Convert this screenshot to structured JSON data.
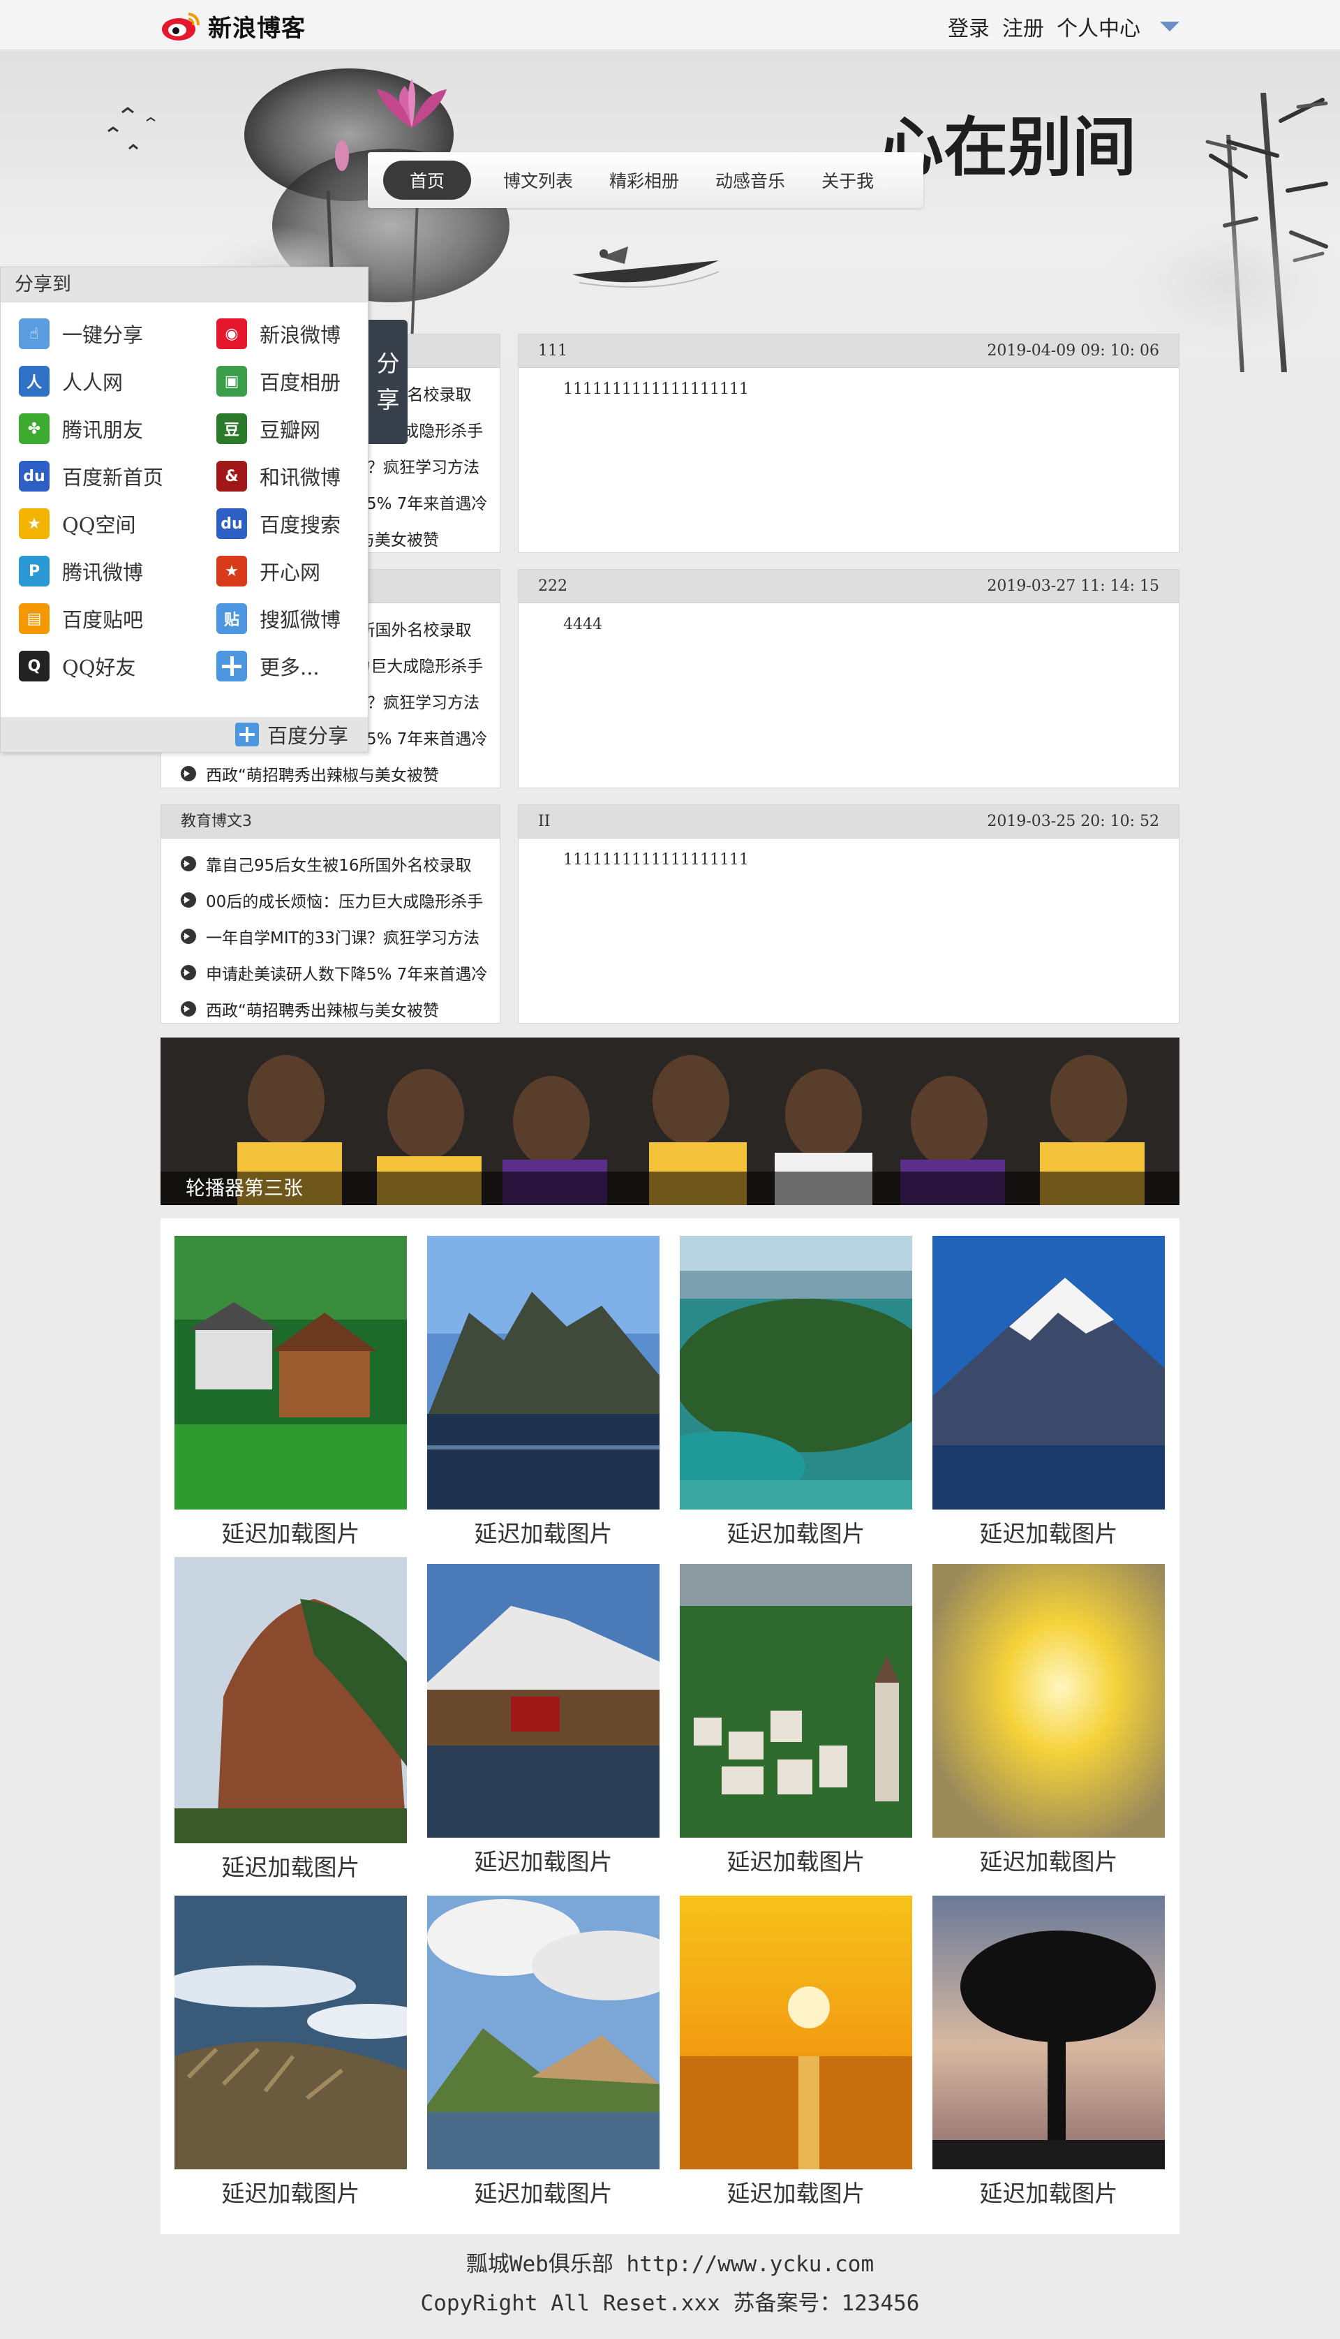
{
  "header": {
    "logo_text": "新浪博客",
    "links": [
      "登录",
      "注册",
      "个人中心"
    ]
  },
  "banner": {
    "calligraphy": "心在别间"
  },
  "nav": {
    "items": [
      "首页",
      "博文列表",
      "精彩相册",
      "动感音乐",
      "关于我"
    ]
  },
  "sections": [
    {
      "category": "",
      "articles": [
        "靠自己95后女生被16所国外名校录取",
        "00后的成长烦恼：压力巨大成隐形杀手",
        "一年自学MIT的33门课？疯狂学习方法",
        "申请赴美读研人数下降5% 7年来首遇冷",
        "西政“萌招聘秀出辣椒与美女被赞"
      ],
      "post_title": "111",
      "post_date": "2019-04-09 09: 10: 06",
      "post_body": "1111111111111111111"
    },
    {
      "category": "",
      "articles": [
        "靠自己95后女生被16所国外名校录取",
        "00后的成长烦恼：压力巨大成隐形杀手",
        "一年自学MIT的33门课？疯狂学习方法",
        "申请赴美读研人数下降5% 7年来首遇冷",
        "西政“萌招聘秀出辣椒与美女被赞"
      ],
      "post_title": "222",
      "post_date": "2019-03-27 11: 14: 15",
      "post_body": "4444"
    },
    {
      "category": "教育博文3",
      "articles": [
        "靠自己95后女生被16所国外名校录取",
        "00后的成长烦恼：压力巨大成隐形杀手",
        "一年自学MIT的33门课？疯狂学习方法",
        "申请赴美读研人数下降5% 7年来首遇冷",
        "西政“萌招聘秀出辣椒与美女被赞"
      ],
      "post_title": "II",
      "post_date": "2019-03-25 20: 10: 52",
      "post_body": "1111111111111111111"
    }
  ],
  "carousel": {
    "caption": "轮播器第三张"
  },
  "gallery": {
    "caption": "延迟加载图片",
    "photos": [
      "house-forest",
      "karst-lake",
      "island-lake",
      "snow-mountain",
      "red-cliff",
      "snow-mountain-pavilion",
      "village-church",
      "golden-sky",
      "snowy-river",
      "green-hills-lake",
      "sunset-sea",
      "lone-tree"
    ]
  },
  "footer": {
    "line1": "瓢城Web俱乐部 http://www.ycku.com",
    "line2": "CopyRight All Reset.xxx 苏备案号：123456"
  },
  "share": {
    "title": "分享到",
    "tab": [
      "分",
      "享"
    ],
    "items": [
      {
        "label": "一键分享",
        "icon": "one-click-share-icon",
        "color": "#5b9be0"
      },
      {
        "label": "新浪微博",
        "icon": "sina-weibo-icon",
        "color": "#e6162d"
      },
      {
        "label": "人人网",
        "icon": "renren-icon",
        "color": "#2f71c4"
      },
      {
        "label": "百度相册",
        "icon": "baidu-album-icon",
        "color": "#3a9e4a"
      },
      {
        "label": "腾讯朋友",
        "icon": "tencent-friends-icon",
        "color": "#3dab2f"
      },
      {
        "label": "豆瓣网",
        "icon": "douban-icon",
        "color": "#2b7a2b"
      },
      {
        "label": "百度新首页",
        "icon": "baidu-home-icon",
        "color": "#2e5fc4"
      },
      {
        "label": "和讯微博",
        "icon": "hexun-weibo-icon",
        "color": "#a01818"
      },
      {
        "label": "QQ空间",
        "icon": "qzone-icon",
        "color": "#f2b400"
      },
      {
        "label": "百度搜索",
        "icon": "baidu-search-icon",
        "color": "#2e5fc4"
      },
      {
        "label": "腾讯微博",
        "icon": "tencent-weibo-icon",
        "color": "#2a98d4"
      },
      {
        "label": "开心网",
        "icon": "kaixin-icon",
        "color": "#d93a1a"
      },
      {
        "label": "百度贴吧",
        "icon": "baidu-tieba-icon",
        "color": "#f39800"
      },
      {
        "label": "搜狐微博",
        "icon": "sohu-weibo-icon",
        "color": "#4c97e0"
      },
      {
        "label": "QQ好友",
        "icon": "qq-friends-icon",
        "color": "#222222"
      },
      {
        "label": "更多...",
        "icon": "more-icon",
        "color": "#4c97e0"
      }
    ],
    "footer": "百度分享"
  }
}
